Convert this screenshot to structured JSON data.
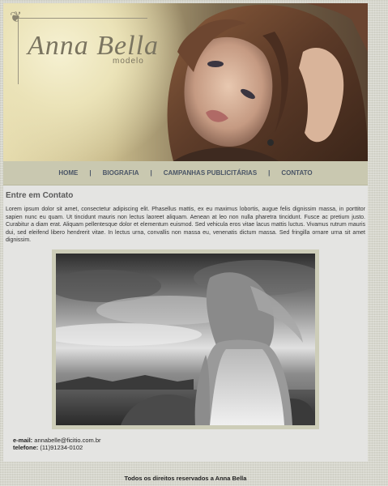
{
  "brand": {
    "name": "Anna Bella",
    "subtitle": "modelo",
    "flower_icon": "fleur-icon"
  },
  "nav": {
    "items": [
      {
        "label": "HOME"
      },
      {
        "label": "BIOGRAFIA"
      },
      {
        "label": "CAMPANHAS PUBLICITÁRIAS"
      },
      {
        "label": "CONTATO"
      }
    ],
    "separator": "|"
  },
  "content": {
    "heading": "Entre em Contato",
    "body": "Lorem ipsum dolor sit amet, consectetur adipiscing elit. Phasellus mattis, ex eu maximus lobortis, augue felis dignissim massa, in porttitor sapien nunc eu quam. Ut tincidunt mauris non lectus laoreet aliquam. Aenean at leo non nulla pharetra tincidunt. Fusce ac pretium justo. Curabitur a diam erat. Aliquam pellentesque dolor et elementum euismod. Sed vehicula eros vitae lacus mattis luctus. Vivamus rutrum mauris dui, sed eleifend libero hendrerit vitae. In lectus urna, convallis non massa eu, venenatis dictum massa. Sed fringilla ornare urna sit amet dignissim."
  },
  "contact": {
    "email_label": "e-mail:",
    "email_value": "annabelle@ficitio.com.br",
    "phone_label": "telefone:",
    "phone_value": "(11)91234-0102"
  },
  "footer": {
    "text": "Todos os direitos reservados a Anna Bella"
  },
  "colors": {
    "nav_bg": "#c9c8b0",
    "nav_text": "#4a5566",
    "page_bg": "#e4e4e2"
  }
}
